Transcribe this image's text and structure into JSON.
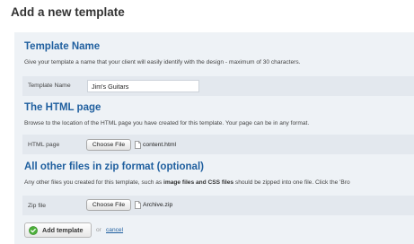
{
  "page": {
    "title": "Add a new template"
  },
  "sections": {
    "name": {
      "title": "Template Name",
      "description": "Give your template a name that your client will easily identify with the design - maximum of 30 characters.",
      "field_label": "Template Name",
      "field_value": "Jim's Guitars"
    },
    "html": {
      "title": "The HTML page",
      "description": "Browse to the location of the HTML page you have created for this template. Your page can be in any format.",
      "field_label": "HTML page",
      "button_label": "Choose File",
      "file_name": "content.html"
    },
    "zip": {
      "title": "All other files in zip format (optional)",
      "description_start": "Any other files you created for this template, such as ",
      "description_bold": "image files and CSS files",
      "description_end": " should be zipped into one file. Click the 'Bro",
      "field_label": "Zip file",
      "button_label": "Choose File",
      "file_name": "Archive.zip"
    }
  },
  "actions": {
    "add_label": "Add template",
    "or_text": "or",
    "cancel_label": "cancel"
  },
  "icons": {
    "add": "green-check-circle-icon",
    "file": "document-icon"
  },
  "colors": {
    "heading": "#1f5f9f",
    "panel": "#eef2f6",
    "field_row": "#e3e8ee",
    "add_icon": "#4caf3a"
  }
}
